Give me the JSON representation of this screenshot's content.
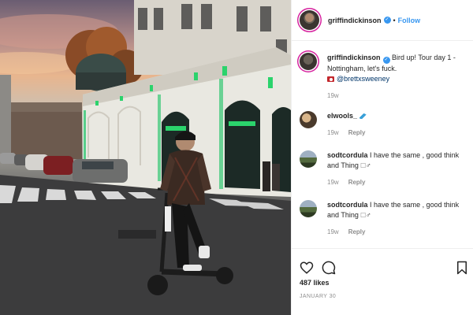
{
  "header": {
    "username": "griffindickinson",
    "verified": true,
    "separator": "•",
    "follow_label": "Follow"
  },
  "caption": {
    "username": "griffindickinson",
    "text": "Bird up! Tour day 1 - Nottingham, let's fuck.",
    "photo_credit_icon": "camera-icon",
    "mention": "@brettxsweeney",
    "time": "19w"
  },
  "comments": [
    {
      "username": "elwools_",
      "text": "",
      "emoji_icon": "water-wave-icon",
      "time": "19w",
      "reply_label": "Reply"
    },
    {
      "username": "sodtcordula",
      "text": "I have the same , good think and Thing 🗆♂",
      "time": "19w",
      "reply_label": "Reply"
    },
    {
      "username": "sodtcordula",
      "text": "I have the same , good think and Thing 🗆♂",
      "time": "19w",
      "reply_label": "Reply"
    }
  ],
  "actions": {
    "icons": [
      "heart-icon",
      "comment-icon",
      "bookmark-icon"
    ]
  },
  "likes_label": "487 likes",
  "date_label": "JANUARY 30",
  "colors": {
    "accent": "#3897f0",
    "text": "#262626",
    "muted": "#8e8e8e",
    "story_ring": "#d6249f"
  }
}
